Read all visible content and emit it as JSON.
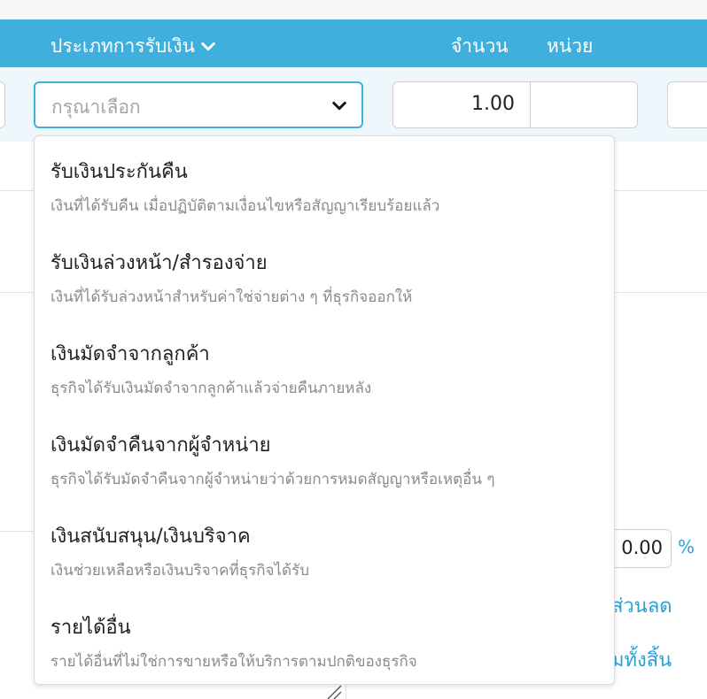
{
  "header": {
    "type_label": "ประเภทการรับเงิน",
    "quantity_label": "จำนวน",
    "unit_label": "หน่วย"
  },
  "form": {
    "select_placeholder": "กรุณาเลือก",
    "quantity_value": "1.00",
    "unit_value": ""
  },
  "summary": {
    "percent_value": "0.00",
    "percent_symbol": "%",
    "discount_label": "ส่วนลด",
    "total_label": "มทั้งสิ้น"
  },
  "dropdown": {
    "options": [
      {
        "title": "รับเงินประกันคืน",
        "desc": "เงินที่ได้รับคืน เมื่อปฏิบัติตามเงื่อนไขหรือสัญญาเรียบร้อยแล้ว"
      },
      {
        "title": "รับเงินล่วงหน้า/สำรองจ่าย",
        "desc": "เงินที่ได้รับล่วงหน้าสำหรับค่าใช่จ่ายต่าง ๆ ที่ธุรกิจออกให้"
      },
      {
        "title": "เงินมัดจำจากลูกค้า",
        "desc": "ธุรกิจได้รับเงินมัดจำจากลูกค้าแล้วจ่ายคืนภายหลัง"
      },
      {
        "title": "เงินมัดจำคืนจากผู้จำหน่าย",
        "desc": "ธุรกิจได้รับมัดจำคืนจากผู้จำหน่ายว่าด้วยการหมดสัญญาหรือเหตุอื่น ๆ"
      },
      {
        "title": "เงินสนับสนุน/เงินบริจาค",
        "desc": "เงินช่วยเหลือหรือเงินบริจาคที่ธุรกิจได้รับ"
      },
      {
        "title": "รายได้อื่น",
        "desc": "รายได้อื่นที่ไม่ใช่การขายหรือให้บริการตามปกติของธุรกิจ"
      }
    ]
  },
  "colors": {
    "header_bg": "#3fb0de",
    "accent": "#2a9fd8",
    "placeholder": "#a5a5a5"
  },
  "icons": {
    "header_chevron": "chevron-down-icon",
    "select_chevron": "chevron-down-icon",
    "resize_handle": "resize-handle-icon"
  }
}
